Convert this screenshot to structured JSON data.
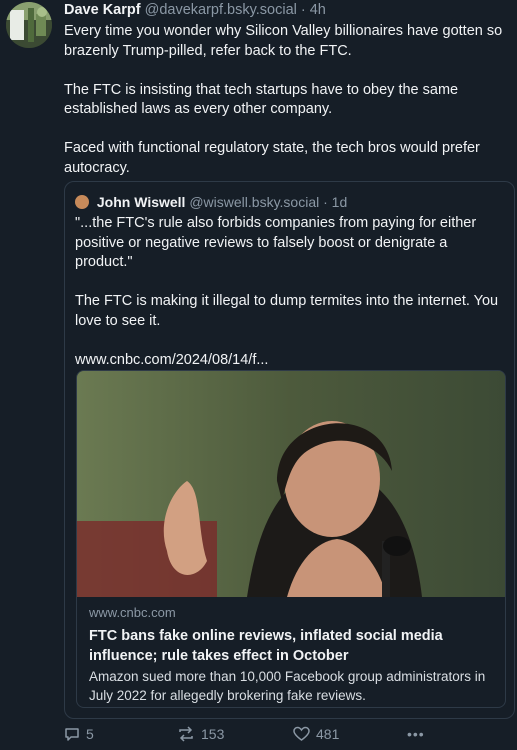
{
  "post": {
    "author_name": "Dave Karpf",
    "author_handle": "@davekarpf.bsky.social",
    "time": "· 4h",
    "paragraphs": [
      "Every time you wonder why Silicon Valley billionaires have gotten so brazenly Trump-pilled, refer back to the FTC.",
      "The FTC is insisting that tech startups have to obey the same established laws as every other company.",
      "Faced with  functional regulatory state, the tech bros would prefer autocracy."
    ]
  },
  "quote": {
    "author_name": "John Wiswell",
    "author_handle": "@wiswell.bsky.social",
    "time": "· 1d",
    "paragraphs": [
      "\"...the FTC's rule also forbids companies from paying for either positive or negative reviews to falsely boost or denigrate a product.\"",
      "The FTC is making it illegal to dump termites into the internet. You love to see it.",
      "www.cnbc.com/2024/08/14/f..."
    ],
    "card": {
      "domain": "www.cnbc.com",
      "title": "FTC bans fake online reviews, inflated social media influence; rule takes effect in October",
      "description": "Amazon sued more than 10,000 Facebook group administrators in July 2022 for allegedly brokering fake reviews."
    }
  },
  "actions": {
    "reply_count": "5",
    "repost_count": "153",
    "like_count": "481",
    "more_label": "•••"
  },
  "colors": {
    "background": "#161e27",
    "text": "#f1f3f5",
    "muted": "#8b98a5",
    "border": "#2e3a47"
  }
}
